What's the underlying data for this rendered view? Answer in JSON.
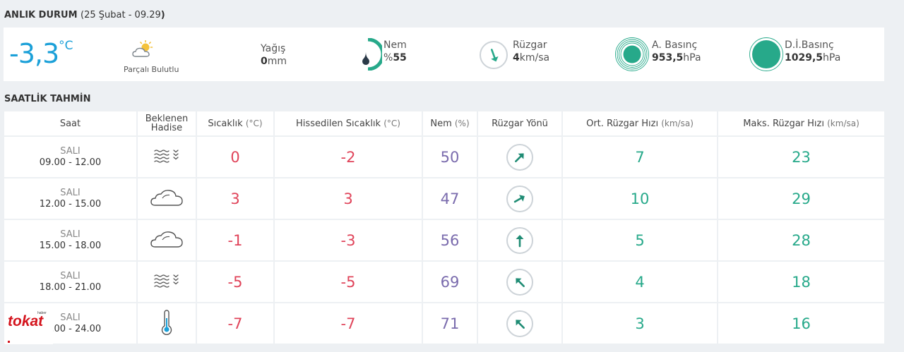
{
  "current": {
    "title": "ANLIK DURUM",
    "date_open": "(",
    "date": "25 Şubat - 09.29",
    "date_close": ")",
    "temperature": "-3,3",
    "temp_unit": "°C",
    "condition": "Parçalı Bulutlu",
    "condition_icon": "partly-cloudy-icon",
    "precip": {
      "label": "Yağış",
      "value": "0",
      "unit": "mm"
    },
    "humidity": {
      "label": "Nem",
      "prefix": "%",
      "value": "55",
      "percent": 55
    },
    "wind": {
      "label": "Rüzgar",
      "value": "4",
      "unit": "km/sa"
    },
    "pressure": {
      "label": "A. Basınç",
      "value": "953,5",
      "unit": "hPa"
    },
    "sea_pressure": {
      "label": "D.İ.Basınç",
      "value": "1029,5",
      "unit": "hPa"
    },
    "accent_blue": "#1ba0d8",
    "accent_teal": "#27a98a"
  },
  "hourly": {
    "title": "SAATLİK TAHMİN",
    "headers": {
      "time": "Saat",
      "event_1": "Beklenen",
      "event_2": "Hadise",
      "temp": "Sıcaklık",
      "temp_unit": "(°C)",
      "feels": "Hissedilen Sıcaklık",
      "feels_unit": "(°C)",
      "hum": "Nem",
      "hum_unit": "(%)",
      "dir": "Rüzgar Yönü",
      "avg": "Ort. Rüzgar Hızı",
      "avg_unit": "(km/sa)",
      "max": "Maks. Rüzgar Hızı",
      "max_unit": "(km/sa)"
    },
    "rows": [
      {
        "day": "SALI",
        "time": "09.00 - 12.00",
        "icon": "fog-icon",
        "temp": "0",
        "feels": "-2",
        "humidity": "50",
        "wind_dir_deg": 45,
        "wind_avg": "7",
        "wind_max": "23"
      },
      {
        "day": "SALI",
        "time": "12.00 - 15.00",
        "icon": "cloud-icon",
        "temp": "3",
        "feels": "3",
        "humidity": "47",
        "wind_dir_deg": 60,
        "wind_avg": "10",
        "wind_max": "29"
      },
      {
        "day": "SALI",
        "time": "15.00 - 18.00",
        "icon": "cloud-icon",
        "temp": "-1",
        "feels": "-3",
        "humidity": "56",
        "wind_dir_deg": 0,
        "wind_avg": "5",
        "wind_max": "28"
      },
      {
        "day": "SALI",
        "time": "18.00 - 21.00",
        "icon": "fog-icon",
        "temp": "-5",
        "feels": "-5",
        "humidity": "69",
        "wind_dir_deg": -45,
        "wind_avg": "4",
        "wind_max": "18"
      },
      {
        "day": "SALI",
        "time": "21.00 - 24.00",
        "icon": "thermometer-icon",
        "temp": "-7",
        "feels": "-7",
        "humidity": "71",
        "wind_dir_deg": -45,
        "wind_avg": "3",
        "wind_max": "16"
      }
    ]
  },
  "watermark": {
    "brand": "tokat",
    "small": "haber"
  }
}
